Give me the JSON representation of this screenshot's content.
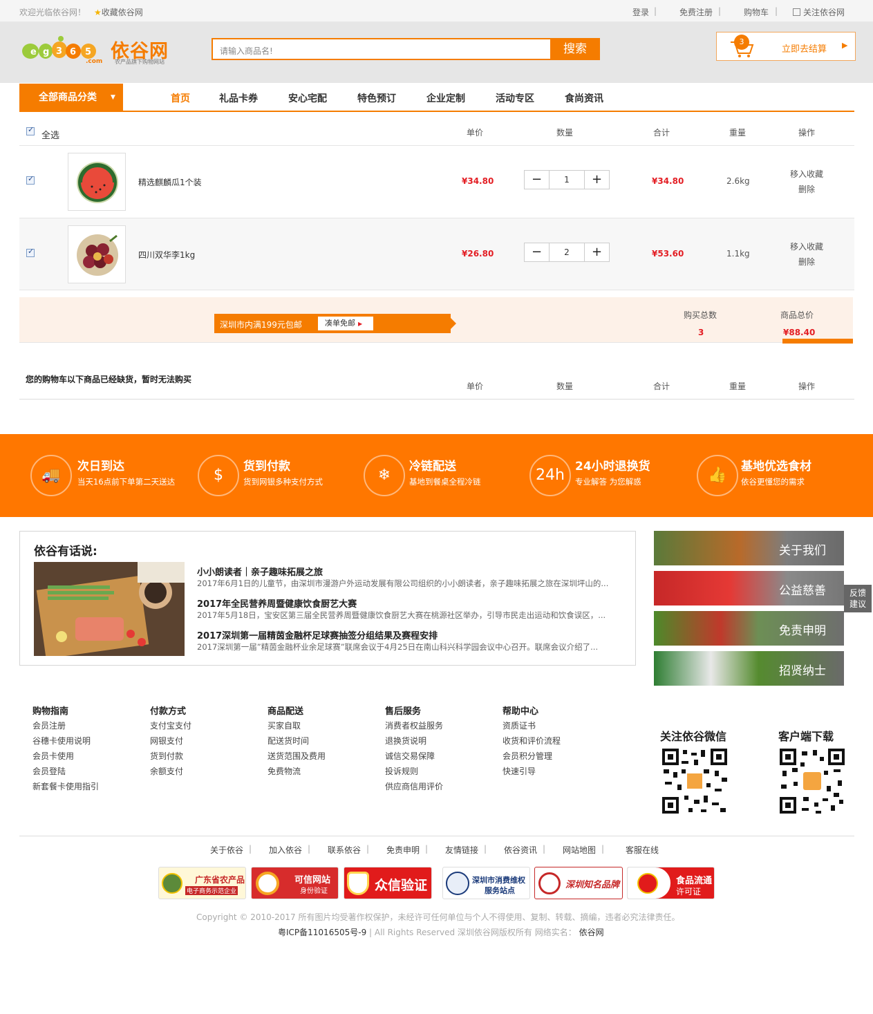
{
  "topbar": {
    "welcome": "欢迎光临依谷网！",
    "favorite": "收藏依谷网",
    "login": "登录",
    "register": "免费注册",
    "cart": "购物车",
    "follow": "关注依谷网"
  },
  "header": {
    "logo_text": "依谷网",
    "logo_sub": "农产品旗下购物网站",
    "logo_domain": ".com",
    "search_placeholder": "请输入商品名!",
    "search_button": "搜索",
    "cart_count": "3",
    "checkout_label": "立即去结算"
  },
  "nav": {
    "all_categories": "全部商品分类",
    "items": [
      "首页",
      "礼品卡券",
      "安心宅配",
      "特色预订",
      "企业定制",
      "活动专区",
      "食尚资讯"
    ]
  },
  "cart": {
    "select_all": "全选",
    "columns": [
      "单价",
      "数量",
      "合计",
      "重量",
      "操作"
    ],
    "rows": [
      {
        "name": "精选麒麟瓜1个装",
        "price": "¥34.80",
        "qty": "1",
        "total": "¥34.80",
        "weight": "2.6kg",
        "action1": "移入收藏",
        "action2": "删除"
      },
      {
        "name": "四川双华李1kg",
        "price": "¥26.80",
        "qty": "2",
        "total": "¥53.60",
        "weight": "1.1kg",
        "action1": "移入收藏",
        "action2": "删除"
      }
    ],
    "shipping_note": "深圳市内满199元包邮",
    "shipping_button": "凑单免邮",
    "total_count_label": "购买总数",
    "total_count": "3",
    "total_price_label": "商品总价",
    "total_price": "¥88.40",
    "out_of_stock_title": "您的购物车以下商品已经缺货，暂时无法购买"
  },
  "features": [
    {
      "title": "次日到达",
      "sub": "当天16点前下单第二天送达",
      "icon": "truck-icon"
    },
    {
      "title": "货到付款",
      "sub": "货到网银多种支付方式",
      "icon": "wallet-icon"
    },
    {
      "title": "冷链配送",
      "sub": "基地到餐桌全程冷链",
      "icon": "thermometer-icon"
    },
    {
      "title": "24小时退换货",
      "sub": "专业解答 为您解惑",
      "icon": "24h-icon",
      "icon_text": "24h"
    },
    {
      "title": "基地优选食材",
      "sub": "依谷更懂您的需求",
      "icon": "thumbs-up-icon"
    }
  ],
  "news": {
    "heading": "依谷有话说:",
    "items": [
      {
        "title": "小小朗读者｜亲子趣味拓展之旅",
        "desc": "2017年6月1日的儿童节，由深圳市漫游户外运动发展有限公司组织的小小朗读者，亲子趣味拓展之旅在深圳坪山的..."
      },
      {
        "title": "2017年全民营养周暨健康饮食厨艺大赛",
        "desc": "2017年5月18日，宝安区第三届全民营养周暨健康饮食厨艺大赛在桃源社区举办，引导市民走出运动和饮食误区，..."
      },
      {
        "title": "2017深圳第一届精茵金融杯足球赛抽签分组结果及赛程安排",
        "desc": "2017深圳第一届”精茵金融杯业余足球赛”联席会议于4月25日在南山科兴科学园会议中心召开。联席会议介绍了..."
      }
    ]
  },
  "side_links": [
    "关于我们",
    "公益慈善",
    "免责申明",
    "招贤纳士"
  ],
  "feedback": "反馈建议",
  "footer": {
    "columns": [
      {
        "title": "购物指南",
        "links": [
          "会员注册",
          "谷穗卡使用说明",
          "会员卡使用",
          "会员登陆",
          "新套餐卡使用指引"
        ]
      },
      {
        "title": "付款方式",
        "links": [
          "支付宝支付",
          "网银支付",
          "货到付款",
          "余额支付"
        ]
      },
      {
        "title": "商品配送",
        "links": [
          "买家自取",
          "配送货时间",
          "送货范围及费用",
          "免费物流"
        ]
      },
      {
        "title": "售后服务",
        "links": [
          "消费者权益服务",
          "退换货说明",
          "诚信交易保障",
          "投诉规则",
          "供应商信用评价"
        ]
      },
      {
        "title": "帮助中心",
        "links": [
          "资质证书",
          "收货和评价流程",
          "会员积分管理",
          "快速引导"
        ]
      }
    ],
    "wechat_title": "关注依谷微信",
    "app_title": "客户端下载",
    "bottom_links": [
      "关于依谷",
      "加入依谷",
      "联系依谷",
      "免责申明",
      "友情链接",
      "依谷资讯",
      "网站地图",
      "客服在线"
    ],
    "badges": [
      {
        "line1": "广东省农产品",
        "line2": "电子商务示范企业"
      },
      {
        "line1": "可信网站",
        "line2": "身份验证"
      },
      {
        "line1": "众信验证",
        "line2": ""
      },
      {
        "line1": "深圳市消费维权",
        "line2": "服务站点"
      },
      {
        "line1": "深圳知名品牌",
        "line2": ""
      },
      {
        "line1": "食品流通",
        "line2": "许可证"
      }
    ],
    "copyright": "Copyright © 2010-2017 所有图片均受著作权保护，未经许可任何单位与个人不得使用、复制、转载、摘编，违者必究法律责任。",
    "icp": "粤ICP备11016505号-9",
    "rights": "| All Rights Reserved 深圳依谷网版权所有 网络实名：",
    "realname": "依谷网"
  }
}
